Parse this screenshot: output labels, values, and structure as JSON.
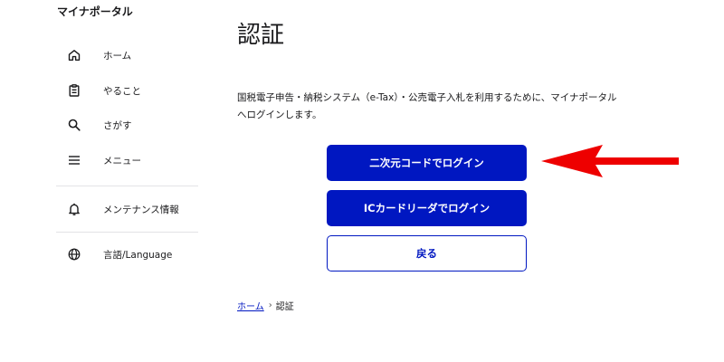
{
  "sidebar": {
    "brand": "マイナポータル",
    "items": [
      {
        "label": "ホーム",
        "icon": "home-icon"
      },
      {
        "label": "やること",
        "icon": "clipboard-icon"
      },
      {
        "label": "さがす",
        "icon": "search-icon"
      },
      {
        "label": "メニュー",
        "icon": "menu-icon"
      },
      {
        "label": "メンテナンス情報",
        "icon": "bell-icon"
      },
      {
        "label": "言語/Language",
        "icon": "globe-icon"
      }
    ]
  },
  "main": {
    "title": "認証",
    "description": "国税電子申告・納税システム（e-Tax）・公売電子入札を利用するために、マイナポータルへログインします。",
    "buttons": {
      "qr_login": "二次元コードでログイン",
      "ic_login": "ICカードリーダでログイン",
      "back": "戻る"
    },
    "annotation": {
      "icon": "red-arrow-icon",
      "color": "#ee0000"
    }
  },
  "breadcrumb": {
    "home": "ホーム",
    "separator": "›",
    "current": "認証"
  },
  "colors": {
    "accent": "#0017c1",
    "arrow": "#ee0000"
  }
}
